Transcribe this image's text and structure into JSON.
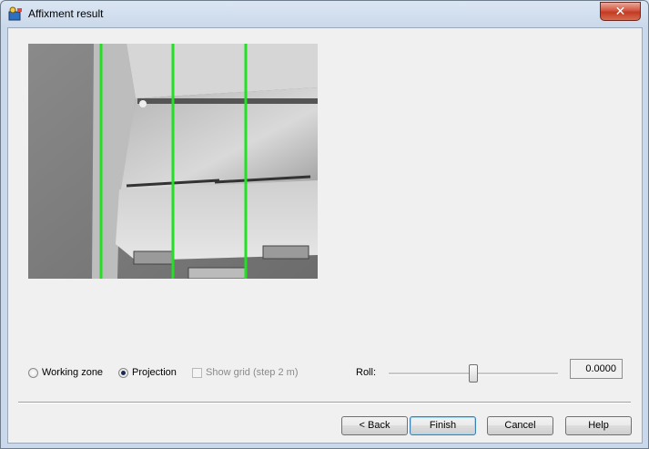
{
  "window": {
    "title": "Affixment result",
    "close_glyph": "✕"
  },
  "icons": {
    "app": "camera-app-icon",
    "close": "close-icon"
  },
  "preview": {
    "description_none": "",
    "line_color": "#22e022"
  },
  "controls": {
    "working_zone": {
      "label": "Working zone",
      "selected": false
    },
    "projection": {
      "label": "Projection",
      "selected": true
    },
    "show_grid": {
      "label": "Show grid (step 2 m)",
      "checked": false,
      "enabled": false
    },
    "roll": {
      "label": "Roll:",
      "value": "0.0000",
      "slider_fraction": 0.5
    }
  },
  "buttons": {
    "back": "< Back",
    "finish": "Finish",
    "cancel": "Cancel",
    "help": "Help"
  }
}
